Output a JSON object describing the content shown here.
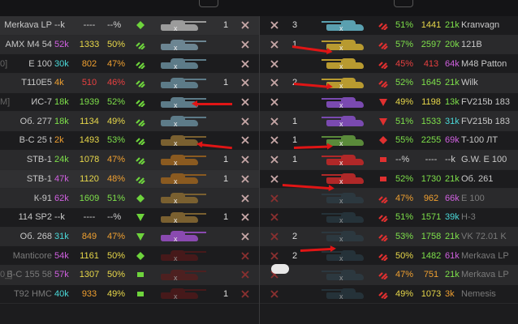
{
  "colors": {
    "green_stat": "#7ee04a",
    "yellow_stat": "#e8d84a",
    "orange_stat": "#f0a030",
    "red_stat": "#e84040",
    "cyan_stat": "#4ad8d8",
    "purple_stat": "#d060e0",
    "rank_green": "#6ed43c",
    "rank_red": "#e03030"
  },
  "left_team": [
    {
      "bracket": "",
      "name": "Merkava LP",
      "bat": "--k",
      "bat_c": "#cfcfcf",
      "wn8": "----",
      "wn8_c": "#cfcfcf",
      "wr": "--%",
      "wr_c": "#cfcfcf",
      "rank": "diamond",
      "rank_c": "#6ed43c",
      "tank_c": "#9b9b9b",
      "squad": "1",
      "dead": false,
      "sel": true
    },
    {
      "bracket": "",
      "name": "AMX M4 54",
      "bat": "52k",
      "bat_c": "#d060e0",
      "wn8": "1333",
      "wn8_c": "#e8d84a",
      "wr": "50%",
      "wr_c": "#e8d84a",
      "rank": "triple",
      "rank_c": "#6ed43c",
      "tank_c": "#6c8592",
      "squad": "",
      "dead": false,
      "sel": false
    },
    {
      "bracket": "0]",
      "name": "E 100",
      "bat": "30k",
      "bat_c": "#4ad8d8",
      "wn8": "802",
      "wn8_c": "#f0a030",
      "wr": "47%",
      "wr_c": "#f0a030",
      "rank": "triple",
      "rank_c": "#6ed43c",
      "tank_c": "#5d7b88",
      "squad": "",
      "dead": false,
      "sel": false
    },
    {
      "bracket": "",
      "name": "T110E5",
      "bat": "4k",
      "bat_c": "#f0a030",
      "wn8": "510",
      "wn8_c": "#e84040",
      "wr": "46%",
      "wr_c": "#e84040",
      "rank": "triple",
      "rank_c": "#6ed43c",
      "tank_c": "#5d7b88",
      "squad": "1",
      "dead": false,
      "sel": false
    },
    {
      "bracket": "M]",
      "name": "ИС-7",
      "bat": "18k",
      "bat_c": "#7ee04a",
      "wn8": "1939",
      "wn8_c": "#7ee04a",
      "wr": "52%",
      "wr_c": "#7ee04a",
      "rank": "triple",
      "rank_c": "#6ed43c",
      "tank_c": "#5d7b88",
      "squad": "",
      "dead": false,
      "sel": false
    },
    {
      "bracket": "",
      "name": "Об. 277",
      "bat": "18k",
      "bat_c": "#7ee04a",
      "wn8": "1134",
      "wn8_c": "#e8d84a",
      "wr": "49%",
      "wr_c": "#e8d84a",
      "rank": "triple",
      "rank_c": "#6ed43c",
      "tank_c": "#5d7b88",
      "squad": "",
      "dead": false,
      "sel": false
    },
    {
      "bracket": "",
      "name": "В-С 25 t",
      "bat": "2k",
      "bat_c": "#f0a030",
      "wn8": "1493",
      "wn8_c": "#e8d84a",
      "wr": "53%",
      "wr_c": "#7ee04a",
      "rank": "triple",
      "rank_c": "#6ed43c",
      "tank_c": "#7a6030",
      "squad": "",
      "dead": false,
      "sel": false
    },
    {
      "bracket": "",
      "name": "STB-1",
      "bat": "24k",
      "bat_c": "#7ee04a",
      "wn8": "1078",
      "wn8_c": "#e8d84a",
      "wr": "47%",
      "wr_c": "#f0a030",
      "rank": "triple",
      "rank_c": "#6ed43c",
      "tank_c": "#8a5a20",
      "squad": "1",
      "dead": false,
      "sel": false
    },
    {
      "bracket": "",
      "name": "STB-1",
      "bat": "47k",
      "bat_c": "#d060e0",
      "wn8": "1120",
      "wn8_c": "#e8d84a",
      "wr": "48%",
      "wr_c": "#f0a030",
      "rank": "triple",
      "rank_c": "#6ed43c",
      "tank_c": "#8a5a20",
      "squad": "1",
      "dead": false,
      "sel": true
    },
    {
      "bracket": "",
      "name": "К-91",
      "bat": "62k",
      "bat_c": "#d060e0",
      "wn8": "1609",
      "wn8_c": "#7ee04a",
      "wr": "51%",
      "wr_c": "#7ee04a",
      "rank": "diamond",
      "rank_c": "#6ed43c",
      "tank_c": "#7a6030",
      "squad": "",
      "dead": false,
      "sel": false
    },
    {
      "bracket": "",
      "name": "114 SP2",
      "bat": "--k",
      "bat_c": "#cfcfcf",
      "wn8": "----",
      "wn8_c": "#cfcfcf",
      "wr": "--%",
      "wr_c": "#cfcfcf",
      "rank": "tri-down",
      "rank_c": "#6ed43c",
      "tank_c": "#7a6030",
      "squad": "1",
      "dead": false,
      "sel": false
    },
    {
      "bracket": "",
      "name": "Об. 268",
      "bat": "31k",
      "bat_c": "#4ad8d8",
      "wn8": "849",
      "wn8_c": "#f0a030",
      "wr": "47%",
      "wr_c": "#f0a030",
      "rank": "tri-down",
      "rank_c": "#6ed43c",
      "tank_c": "#8a4ab0",
      "squad": "",
      "dead": false,
      "sel": false
    },
    {
      "bracket": "",
      "name": "Manticore",
      "bat": "54k",
      "bat_c": "#d060e0",
      "wn8": "1161",
      "wn8_c": "#e8d84a",
      "wr": "50%",
      "wr_c": "#e8d84a",
      "rank": "diamond",
      "rank_c": "#6ed43c",
      "tank_c": "#6a1818",
      "squad": "",
      "dead": true,
      "sel": false
    },
    {
      "bracket": "0_]",
      "name": "В-С 155 58",
      "bat": "57k",
      "bat_c": "#d060e0",
      "wn8": "1307",
      "wn8_c": "#e8d84a",
      "wr": "50%",
      "wr_c": "#e8d84a",
      "rank": "square",
      "rank_c": "#6ed43c",
      "tank_c": "#6a1818",
      "squad": "",
      "dead": true,
      "sel": false
    },
    {
      "bracket": "",
      "name": "T92 HMC",
      "bat": "40k",
      "bat_c": "#4ad8d8",
      "wn8": "933",
      "wn8_c": "#f0a030",
      "wr": "49%",
      "wr_c": "#e8d84a",
      "rank": "square",
      "rank_c": "#6ed43c",
      "tank_c": "#6a1818",
      "squad": "1",
      "dead": true,
      "sel": false
    }
  ],
  "right_team": [
    {
      "name": "Kranvagn",
      "bat": "21k",
      "bat_c": "#7ee04a",
      "wn8": "1441",
      "wn8_c": "#e8d84a",
      "wr": "51%",
      "wr_c": "#7ee04a",
      "rank": "triple",
      "rank_c": "#e03030",
      "tank_c": "#5aa0b0",
      "squad": "3",
      "dead": false
    },
    {
      "name": "121B",
      "bat": "20k",
      "bat_c": "#7ee04a",
      "wn8": "2597",
      "wn8_c": "#7ee04a",
      "wr": "57%",
      "wr_c": "#7ee04a",
      "rank": "triple",
      "rank_c": "#e03030",
      "tank_c": "#b89a30",
      "squad": "1",
      "dead": false
    },
    {
      "name": "M48 Patton",
      "bat": "64k",
      "bat_c": "#d060e0",
      "wn8": "413",
      "wn8_c": "#e84040",
      "wr": "45%",
      "wr_c": "#e84040",
      "rank": "triple",
      "rank_c": "#e03030",
      "tank_c": "#b89a30",
      "squad": "",
      "dead": false
    },
    {
      "name": "Wilk",
      "bat": "21k",
      "bat_c": "#7ee04a",
      "wn8": "1645",
      "wn8_c": "#7ee04a",
      "wr": "52%",
      "wr_c": "#7ee04a",
      "rank": "triple",
      "rank_c": "#e03030",
      "tank_c": "#b89a30",
      "squad": "2",
      "dead": false
    },
    {
      "name": "FV215b 183",
      "bat": "13k",
      "bat_c": "#7ee04a",
      "wn8": "1198",
      "wn8_c": "#e8d84a",
      "wr": "49%",
      "wr_c": "#e8d84a",
      "rank": "tri-down",
      "rank_c": "#e03030",
      "tank_c": "#7a4ab0",
      "squad": "",
      "dead": false
    },
    {
      "name": "FV215b 183",
      "bat": "31k",
      "bat_c": "#4ad8d8",
      "wn8": "1533",
      "wn8_c": "#7ee04a",
      "wr": "51%",
      "wr_c": "#7ee04a",
      "rank": "tri-down",
      "rank_c": "#e03030",
      "tank_c": "#7a4ab0",
      "squad": "1",
      "dead": false
    },
    {
      "name": "T-100 ЛТ",
      "bat": "69k",
      "bat_c": "#d060e0",
      "wn8": "2255",
      "wn8_c": "#7ee04a",
      "wr": "55%",
      "wr_c": "#7ee04a",
      "rank": "diamond",
      "rank_c": "#e03030",
      "tank_c": "#5a8a3a",
      "squad": "1",
      "dead": false
    },
    {
      "name": "G.W. E 100",
      "bat": "--k",
      "bat_c": "#cfcfcf",
      "wn8": "----",
      "wn8_c": "#cfcfcf",
      "wr": "--%",
      "wr_c": "#cfcfcf",
      "rank": "square",
      "rank_c": "#e03030",
      "tank_c": "#b02828",
      "squad": "1",
      "dead": false
    },
    {
      "name": "Об. 261",
      "bat": "21k",
      "bat_c": "#7ee04a",
      "wn8": "1730",
      "wn8_c": "#7ee04a",
      "wr": "52%",
      "wr_c": "#7ee04a",
      "rank": "square",
      "rank_c": "#e03030",
      "tank_c": "#b02828",
      "squad": "",
      "dead": false
    },
    {
      "name": "E 100",
      "bat": "66k",
      "bat_c": "#d060e0",
      "wn8": "962",
      "wn8_c": "#f0a030",
      "wr": "47%",
      "wr_c": "#f0a030",
      "rank": "triple",
      "rank_c": "#e03030",
      "tank_c": "#2e4450",
      "squad": "",
      "dead": true
    },
    {
      "name": "Н-3",
      "bat": "39k",
      "bat_c": "#4ad8d8",
      "wn8": "1571",
      "wn8_c": "#7ee04a",
      "wr": "51%",
      "wr_c": "#7ee04a",
      "rank": "triple",
      "rank_c": "#e03030",
      "tank_c": "#2e4450",
      "squad": "",
      "dead": true
    },
    {
      "name": "VK 72.01 K",
      "bat": "21k",
      "bat_c": "#7ee04a",
      "wn8": "1758",
      "wn8_c": "#7ee04a",
      "wr": "53%",
      "wr_c": "#7ee04a",
      "rank": "triple",
      "rank_c": "#e03030",
      "tank_c": "#2e4450",
      "squad": "2",
      "dead": true
    },
    {
      "name": "Merkava LP",
      "bat": "61k",
      "bat_c": "#d060e0",
      "wn8": "1482",
      "wn8_c": "#7ee04a",
      "wr": "50%",
      "wr_c": "#e8d84a",
      "rank": "triple",
      "rank_c": "#e03030",
      "tank_c": "#2e4450",
      "squad": "2",
      "dead": true
    },
    {
      "name": "Merkava LP",
      "bat": "21k",
      "bat_c": "#7ee04a",
      "wn8": "751",
      "wn8_c": "#f0a030",
      "wr": "47%",
      "wr_c": "#f0a030",
      "rank": "triple",
      "rank_c": "#e03030",
      "tank_c": "#2e4450",
      "squad": "",
      "dead": true
    },
    {
      "name": "Nemesis",
      "bat": "3k",
      "bat_c": "#f0a030",
      "wn8": "1073",
      "wn8_c": "#e8d84a",
      "wr": "49%",
      "wr_c": "#e8d84a",
      "rank": "triple",
      "rank_c": "#e03030",
      "tank_c": "#2e4450",
      "squad": "",
      "dead": true
    }
  ]
}
